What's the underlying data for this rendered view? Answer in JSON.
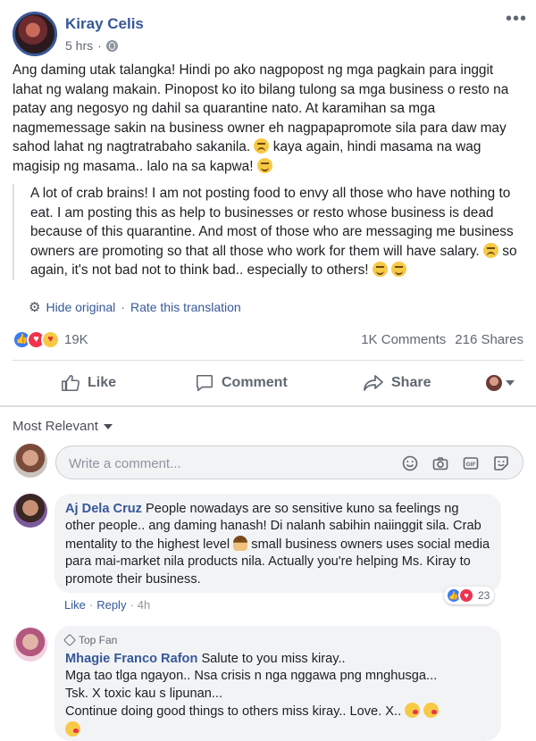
{
  "post": {
    "author": "Kiray Celis",
    "time": "5 hrs",
    "more_label": "•••",
    "text": "Ang daming utak talangka! Hindi po ako nagpopost ng mga pagkain para inggit lahat ng walang makain. Pinopost ko ito bilang tulong sa mga business o resto na patay ang negosyo ng dahil sa quarantine nato. At karamihan sa mga nagmemessage sakin na business owner eh nagpapapromote sila para daw may sahod lahat ng nagtratrabaho sakanila.",
    "text_tail": "kaya again, hindi masama na wag magisip ng masama.. lalo na sa kapwa!",
    "translation": "A lot of crab brains! I am not posting food to envy all those who have nothing to eat. I am posting this as help to businesses or resto whose business is dead because of this quarantine. And most of those who are messaging me business owners are promoting so that all those who work for them will have salary.",
    "translation_tail": "so again, it's not bad not to think bad.. especially to others!",
    "hide_original": "Hide original",
    "rate_translation": "Rate this translation",
    "link_separator": "·",
    "reaction_count": "19K",
    "comments_count": "1K Comments",
    "shares_count": "216 Shares"
  },
  "actions": {
    "like": "Like",
    "comment": "Comment",
    "share": "Share"
  },
  "comments_section": {
    "sort_label": "Most Relevant",
    "input_placeholder": "Write a comment..."
  },
  "comments": [
    {
      "name": "Aj Dela Cruz",
      "text": "People nowadays are so sensitive kuno sa feelings ng other people.. ang daming hanash! Di nalanh sabihin naiinggit sila. Crab mentality to the highest level",
      "text_tail": "small business owners uses social media para mai-market nila products nila. Actually you're helping Ms. Kiray to promote their business.",
      "reactions": "23",
      "like": "Like",
      "reply": "Reply",
      "time": "4h",
      "link_separator": "·"
    },
    {
      "badge": "Top Fan",
      "name": "Mhagie Franco Rafon",
      "line1": "Salute to you miss kiray..",
      "line2": "Mga tao tlga ngayon.. Nsa crisis n nga nggawa png mnghusga...",
      "line3": "Tsk. X toxic kau s lipunan...",
      "line4": "Continue doing good things to others miss kiray.. Love. X.."
    }
  ],
  "colors": {
    "link_blue": "#365899",
    "like_blue": "#3b7bf6",
    "love_red": "#f0334e",
    "bubble_gray": "#f2f3f5"
  }
}
